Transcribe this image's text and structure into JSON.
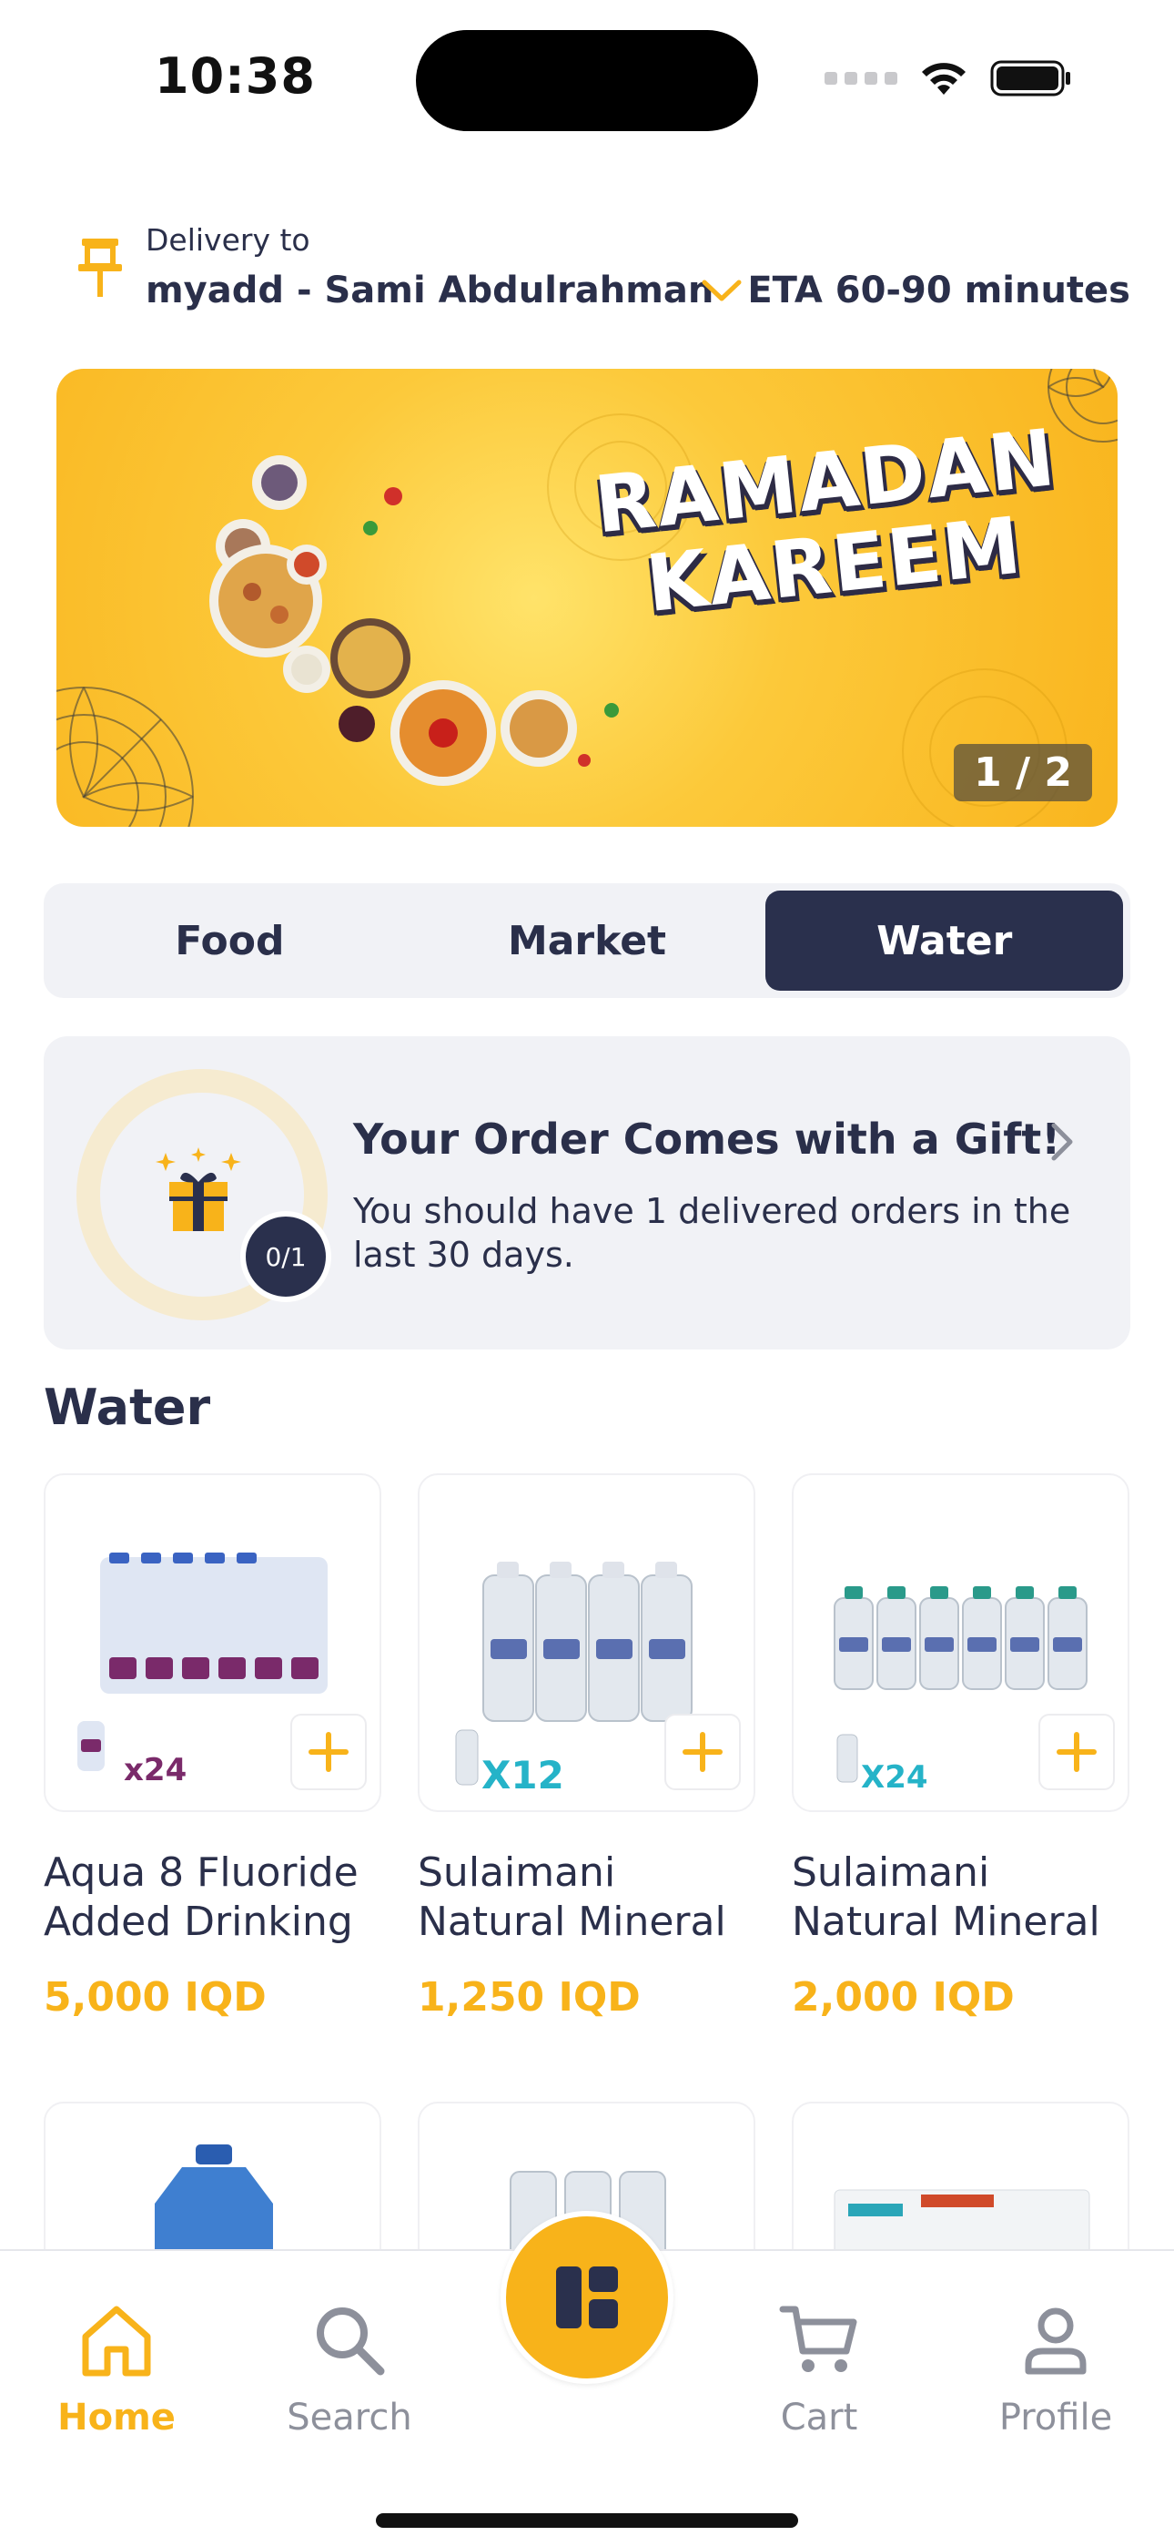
{
  "status_bar": {
    "time": "10:38"
  },
  "delivery": {
    "label": "Delivery to",
    "address": "myadd - Sami Abdulrahman",
    "eta": "ETA 60-90 minutes"
  },
  "banner": {
    "title_line1": "RAMADAN",
    "title_line2": "KAREEM",
    "counter": "1 / 2"
  },
  "segments": [
    {
      "label": "Food",
      "active": false
    },
    {
      "label": "Market",
      "active": false
    },
    {
      "label": "Water",
      "active": true
    }
  ],
  "gift": {
    "progress": "0/1",
    "title": "Your Order Comes with a Gift!",
    "description": "You should have 1 delivered orders in the last 30 days."
  },
  "section": {
    "title": "Water"
  },
  "products": [
    {
      "name": "Aqua 8 Fluoride Added Drinking",
      "price": "5,000 IQD",
      "pack": "x24"
    },
    {
      "name": "Sulaimani Natural Mineral",
      "price": "1,250 IQD",
      "pack": "X12"
    },
    {
      "name": "Sulaimani Natural Mineral",
      "price": "2,000 IQD",
      "pack": "X24"
    }
  ],
  "bottom_nav": [
    {
      "label": "Home",
      "icon": "home-icon",
      "active": true
    },
    {
      "label": "Search",
      "icon": "search-icon",
      "active": false
    },
    {
      "label": "Cart",
      "icon": "cart-icon",
      "active": false
    },
    {
      "label": "Profile",
      "icon": "profile-icon",
      "active": false
    }
  ],
  "colors": {
    "accent": "#f8b31a",
    "navy": "#2a304d",
    "muted": "#8d909b",
    "card_bg": "#f1f2f6"
  }
}
